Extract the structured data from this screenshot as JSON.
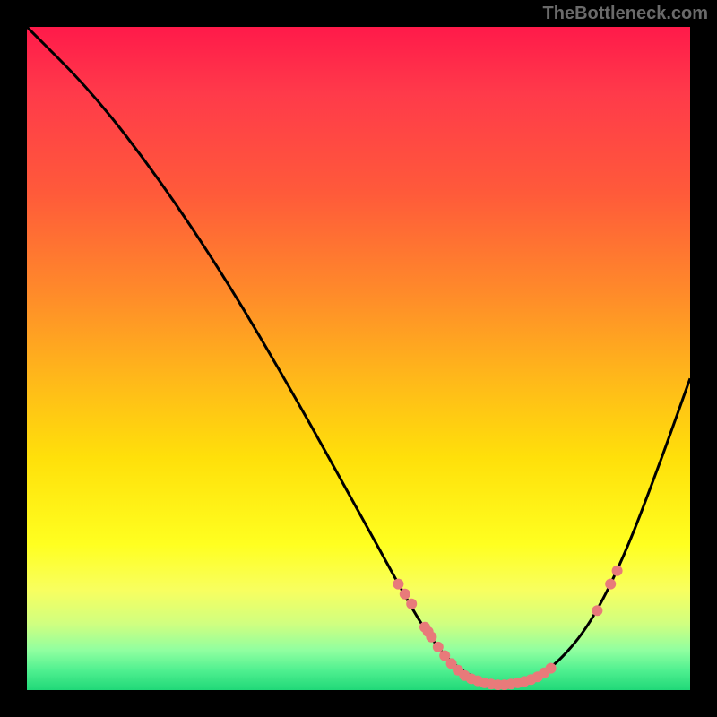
{
  "attribution": "TheBottleneck.com",
  "chart_data": {
    "type": "line",
    "title": "",
    "xlabel": "",
    "ylabel": "",
    "xlim": [
      0,
      100
    ],
    "ylim": [
      0,
      100
    ],
    "curve": [
      {
        "x": 0,
        "y": 100
      },
      {
        "x": 10,
        "y": 90
      },
      {
        "x": 20,
        "y": 77
      },
      {
        "x": 30,
        "y": 62
      },
      {
        "x": 40,
        "y": 45
      },
      {
        "x": 50,
        "y": 27
      },
      {
        "x": 56,
        "y": 16
      },
      {
        "x": 60,
        "y": 9
      },
      {
        "x": 64,
        "y": 4
      },
      {
        "x": 68,
        "y": 1.5
      },
      {
        "x": 72,
        "y": 0.8
      },
      {
        "x": 76,
        "y": 1.5
      },
      {
        "x": 80,
        "y": 4
      },
      {
        "x": 85,
        "y": 10
      },
      {
        "x": 90,
        "y": 20
      },
      {
        "x": 95,
        "y": 33
      },
      {
        "x": 100,
        "y": 47
      }
    ],
    "dots": [
      {
        "x": 56,
        "y": 16
      },
      {
        "x": 57,
        "y": 14.5
      },
      {
        "x": 58,
        "y": 13
      },
      {
        "x": 60,
        "y": 9.5
      },
      {
        "x": 60.5,
        "y": 8.8
      },
      {
        "x": 61,
        "y": 8
      },
      {
        "x": 62,
        "y": 6.5
      },
      {
        "x": 63,
        "y": 5.2
      },
      {
        "x": 64,
        "y": 4
      },
      {
        "x": 65,
        "y": 3
      },
      {
        "x": 66,
        "y": 2.2
      },
      {
        "x": 67,
        "y": 1.7
      },
      {
        "x": 68,
        "y": 1.4
      },
      {
        "x": 69,
        "y": 1.1
      },
      {
        "x": 70,
        "y": 0.9
      },
      {
        "x": 71,
        "y": 0.8
      },
      {
        "x": 72,
        "y": 0.8
      },
      {
        "x": 73,
        "y": 0.9
      },
      {
        "x": 74,
        "y": 1.1
      },
      {
        "x": 75,
        "y": 1.3
      },
      {
        "x": 76,
        "y": 1.6
      },
      {
        "x": 77,
        "y": 2
      },
      {
        "x": 78,
        "y": 2.6
      },
      {
        "x": 79,
        "y": 3.3
      },
      {
        "x": 86,
        "y": 12
      },
      {
        "x": 88,
        "y": 16
      },
      {
        "x": 89,
        "y": 18
      }
    ],
    "gradient_stops": [
      {
        "pos": 0,
        "color": "#ff1a4a"
      },
      {
        "pos": 50,
        "color": "#ffb81a"
      },
      {
        "pos": 80,
        "color": "#ffff20"
      },
      {
        "pos": 100,
        "color": "#20d878"
      }
    ]
  }
}
